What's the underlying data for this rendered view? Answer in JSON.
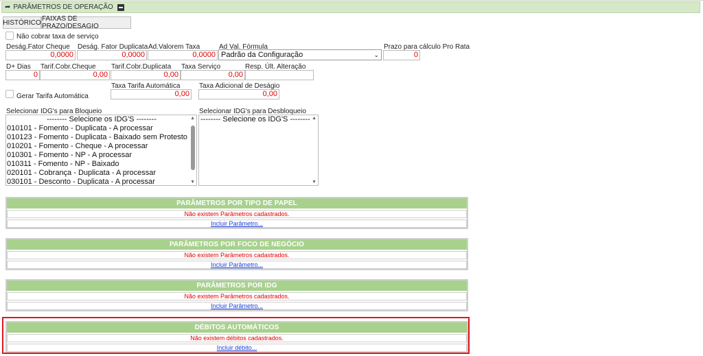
{
  "header": {
    "title": "PARÂMETROS DE OPERAÇÃO"
  },
  "tabs": [
    "HISTÓRICO",
    "FAIXAS DE PRAZO/DESAGIO"
  ],
  "form": {
    "nao_cobrar_label": "Não cobrar taxa de serviço",
    "desag_cheque": {
      "label": "Deság.Fator Cheque",
      "value": "0,0000"
    },
    "desag_duplicata": {
      "label": "Deság. Fator Duplicata",
      "value": "0,0000"
    },
    "ad_valorem": {
      "label": "Ad.Valorem Taxa",
      "value": "0,0000"
    },
    "ad_val_formula": {
      "label": "Ad Val. Fórmula",
      "value": "Padrão da Configuração"
    },
    "prazo_pro_rata": {
      "label": "Prazo para cálculo Pro Rata",
      "value": "0"
    },
    "d_dias": {
      "label": "D+ Dias",
      "value": "0"
    },
    "tarif_cheque": {
      "label": "Tarif.Cobr.Cheque",
      "value": "0,00"
    },
    "tarif_duplicata": {
      "label": "Tarif.Cobr.Duplicata",
      "value": "0,00"
    },
    "taxa_servico": {
      "label": "Taxa Serviço",
      "value": "0,00"
    },
    "resp_alteracao": {
      "label": "Resp. Últ. Alteração",
      "value": ""
    },
    "gerar_tarifa_label": "Gerar Tarifa Automática",
    "taxa_tarifa_auto": {
      "label": "Taxa Tarifa Automática",
      "value": "0,00"
    },
    "taxa_adicional": {
      "label": "Taxa Adicional de Deságio",
      "value": "0,00"
    }
  },
  "idg_bloqueio": {
    "label": "Selecionar IDG's para Bloqueio",
    "options": [
      "-------- Selecione os IDG'S --------",
      "010101 - Fomento - Duplicata - A processar",
      "010123 - Fomento - Duplicata - Baixado sem Protesto",
      "010201 - Fomento - Cheque - A processar",
      "010301 - Fomento - NP - A processar",
      "010311 - Fomento - NP - Baixado",
      "020101 - Cobrança - Duplicata - A processar",
      "030101 - Desconto - Duplicata - A processar"
    ]
  },
  "idg_desbloqueio": {
    "label": "Selecionar IDG's para Desbloqueio",
    "options": [
      "-------- Selecione os IDG'S --------"
    ]
  },
  "panels": [
    {
      "title": "PARÂMETROS POR TIPO DE PAPEL",
      "message": "Não existem Parâmetros cadastrados.",
      "link": "Incluir Parâmetro..."
    },
    {
      "title": "PARÂMETROS POR FOCO DE NEGÓCIO",
      "message": "Não existem Parâmetros cadastrados.",
      "link": "Incluir Parâmetro..."
    },
    {
      "title": "PARÂMETROS POR IDG",
      "message": "Não existem Parâmetros cadastrados.",
      "link": "Incluir Parâmetro..."
    },
    {
      "title": "DÉBITOS AUTOMÁTICOS",
      "message": "Não existem débitos cadastrados.",
      "link": "Incluir débito..."
    }
  ],
  "colors": {
    "header_bg": "#d5e8c8",
    "panel_header": "#a8d18d",
    "error_text": "#e00000",
    "link": "#1a3fd6",
    "highlight": "#e0141e"
  }
}
